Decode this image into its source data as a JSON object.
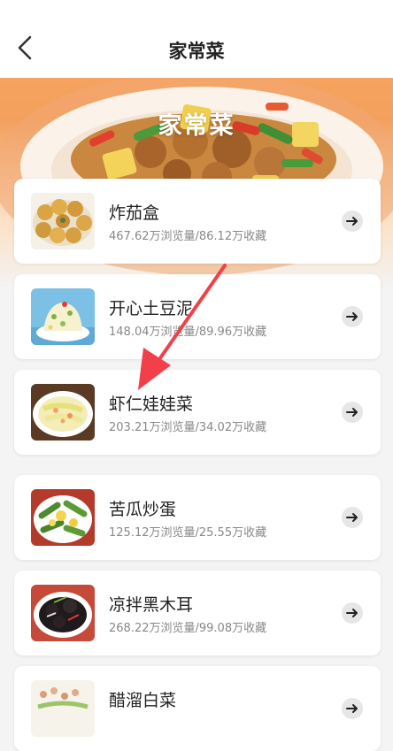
{
  "header": {
    "title": "家常菜",
    "back_icon": "back-arrow-icon"
  },
  "banner": {
    "title": "家常菜"
  },
  "dishes": [
    {
      "name": "炸茄盒",
      "stats": "467.62万浏览量/86.12万收藏"
    },
    {
      "name": "开心土豆泥",
      "stats": "148.04万浏览量/89.96万收藏"
    },
    {
      "name": "虾仁娃娃菜",
      "stats": "203.21万浏览量/34.02万收藏"
    },
    {
      "name": "苦瓜炒蛋",
      "stats": "125.12万浏览量/25.55万收藏"
    },
    {
      "name": "凉拌黑木耳",
      "stats": "268.22万浏览量/99.08万收藏"
    },
    {
      "name": "醋溜白菜",
      "stats": ""
    }
  ],
  "item_action_icon": "arrow-right-icon",
  "colors": {
    "banner_orange": "#f7a35f",
    "annotation_red": "#f1404a",
    "text_primary": "#222222",
    "text_secondary": "#888888"
  }
}
